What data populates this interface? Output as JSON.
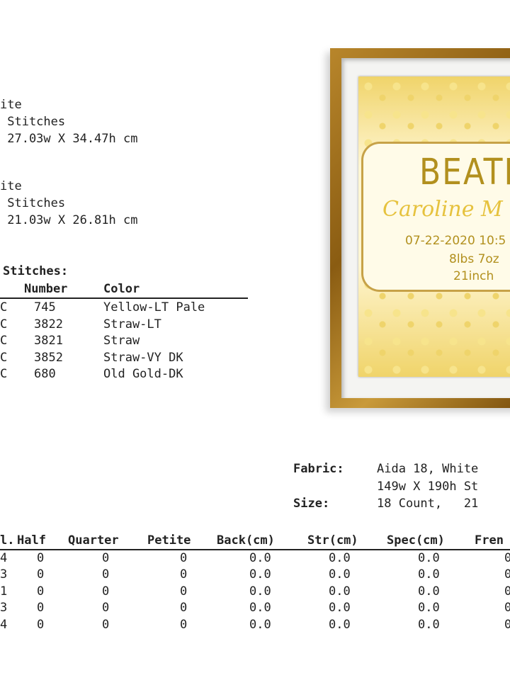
{
  "block1": {
    "fabric": "ite",
    "stitches": " Stitches",
    "size": " 27.03w X 34.47h cm"
  },
  "block2": {
    "fabric": "ite",
    "stitches": " Stitches",
    "size": " 21.03w X 26.81h cm"
  },
  "legend": {
    "heading": "Stitches:",
    "col_number": "Number",
    "col_color": "Color",
    "rows": [
      {
        "brand": "C",
        "number": "745",
        "color": "Yellow-LT Pale"
      },
      {
        "brand": "C",
        "number": "3822",
        "color": "Straw-LT"
      },
      {
        "brand": "C",
        "number": "3821",
        "color": "Straw"
      },
      {
        "brand": "C",
        "number": "3852",
        "color": "Straw-VY DK"
      },
      {
        "brand": "C",
        "number": "680",
        "color": "Old Gold-DK"
      }
    ]
  },
  "picture": {
    "name1": "BEATRIC",
    "name2": "Caroline M",
    "date": "07-22-2020  10:5",
    "weight": "8lbs 7oz",
    "length": "21inch"
  },
  "info": {
    "fabric_label": "Fabric:",
    "fabric_value": "Aida 18, White",
    "stitches_value": "149w X 190h St",
    "size_label": "Size:",
    "size_value": "18 Count,   21"
  },
  "counts": {
    "headers": [
      "l.",
      "Half",
      "Quarter",
      "Petite",
      "Back(cm)",
      "Str(cm)",
      "Spec(cm)",
      "Fren"
    ],
    "rows": [
      {
        "full": "4",
        "half": "0",
        "quarter": "0",
        "petite": "0",
        "back": "0.0",
        "str": "0.0",
        "spec": "0.0",
        "fren": "0"
      },
      {
        "full": "3",
        "half": "0",
        "quarter": "0",
        "petite": "0",
        "back": "0.0",
        "str": "0.0",
        "spec": "0.0",
        "fren": "0"
      },
      {
        "full": "1",
        "half": "0",
        "quarter": "0",
        "petite": "0",
        "back": "0.0",
        "str": "0.0",
        "spec": "0.0",
        "fren": "0"
      },
      {
        "full": "3",
        "half": "0",
        "quarter": "0",
        "petite": "0",
        "back": "0.0",
        "str": "0.0",
        "spec": "0.0",
        "fren": "0"
      },
      {
        "full": "4",
        "half": "0",
        "quarter": "0",
        "petite": "0",
        "back": "0.0",
        "str": "0.0",
        "spec": "0.0",
        "fren": "0"
      }
    ]
  },
  "colors": {
    "frame_gold": "#a8781f",
    "stitch_gold": "#b2901e"
  }
}
